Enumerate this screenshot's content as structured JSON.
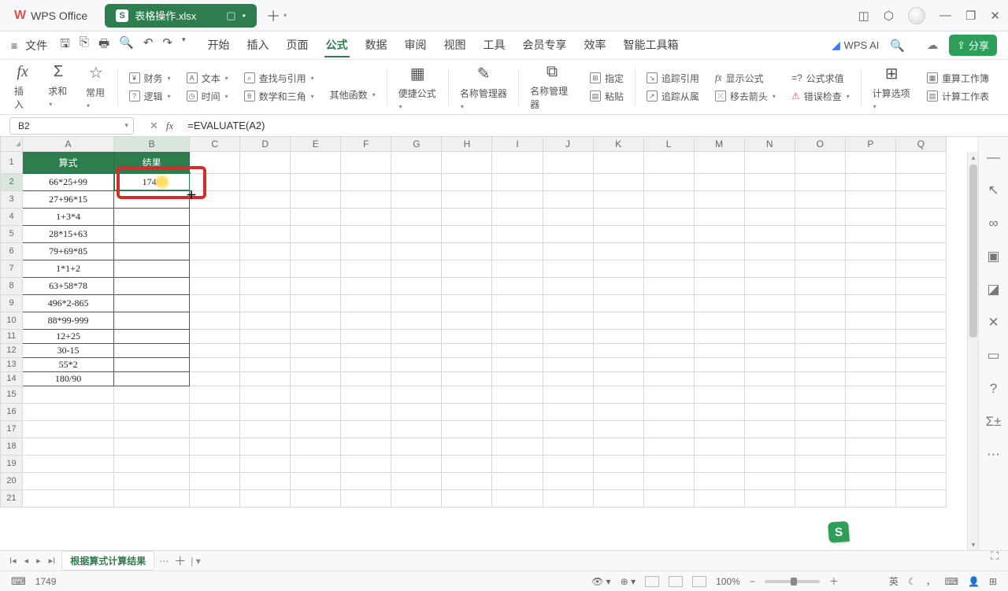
{
  "app": {
    "name": "WPS Office",
    "file_tab": "表格操作.xlsx"
  },
  "menu": {
    "file": "文件",
    "tabs": [
      "开始",
      "插入",
      "页面",
      "公式",
      "数据",
      "审阅",
      "视图",
      "工具",
      "会员专享",
      "效率",
      "智能工具箱"
    ],
    "active_index": 3,
    "ai_label": "WPS AI",
    "share": "分享"
  },
  "ribbon": {
    "insert": "插入",
    "sum": "求和",
    "common": "常用",
    "finance": "财务",
    "text": "文本",
    "lookup": "查找与引用",
    "logic": "逻辑",
    "date": "时间",
    "math": "数学和三角",
    "other": "其他函数",
    "ez": "便捷公式",
    "name_mgr": "名称管理器",
    "define": "指定",
    "paste": "粘贴",
    "trace_prec": "追踪引用",
    "show_formula": "显示公式",
    "eval": "公式求值",
    "trace_dep": "追踪从属",
    "remove_arrow": "移去箭头",
    "error_check": "错误检查",
    "calc_opts": "计算选项",
    "recalc_book": "重算工作簿",
    "calc_sheet": "计算工作表"
  },
  "formula_bar": {
    "cell_ref": "B2",
    "formula": "=EVALUATE(A2)"
  },
  "columns": [
    "A",
    "B",
    "C",
    "D",
    "E",
    "F",
    "G",
    "H",
    "I",
    "J",
    "K",
    "L",
    "M",
    "N",
    "O",
    "P",
    "Q"
  ],
  "headers": {
    "a": "算式",
    "b": "结果"
  },
  "rows": [
    {
      "a": "66*25+99",
      "b": "1749"
    },
    {
      "a": "27+96*15",
      "b": ""
    },
    {
      "a": "1+3*4",
      "b": ""
    },
    {
      "a": "28*15+63",
      "b": ""
    },
    {
      "a": "79+69*85",
      "b": ""
    },
    {
      "a": "1*1+2",
      "b": ""
    },
    {
      "a": "63+58*78",
      "b": ""
    },
    {
      "a": "496*2-865",
      "b": ""
    },
    {
      "a": "88*99-999",
      "b": ""
    },
    {
      "a": "12+25",
      "b": ""
    },
    {
      "a": "30-15",
      "b": ""
    },
    {
      "a": "55*2",
      "b": ""
    },
    {
      "a": "180/90",
      "b": ""
    }
  ],
  "sheet_tabs": {
    "active": "根据算式计算结果"
  },
  "status": {
    "value": "1749",
    "ime": "英",
    "zoom": "100%"
  }
}
